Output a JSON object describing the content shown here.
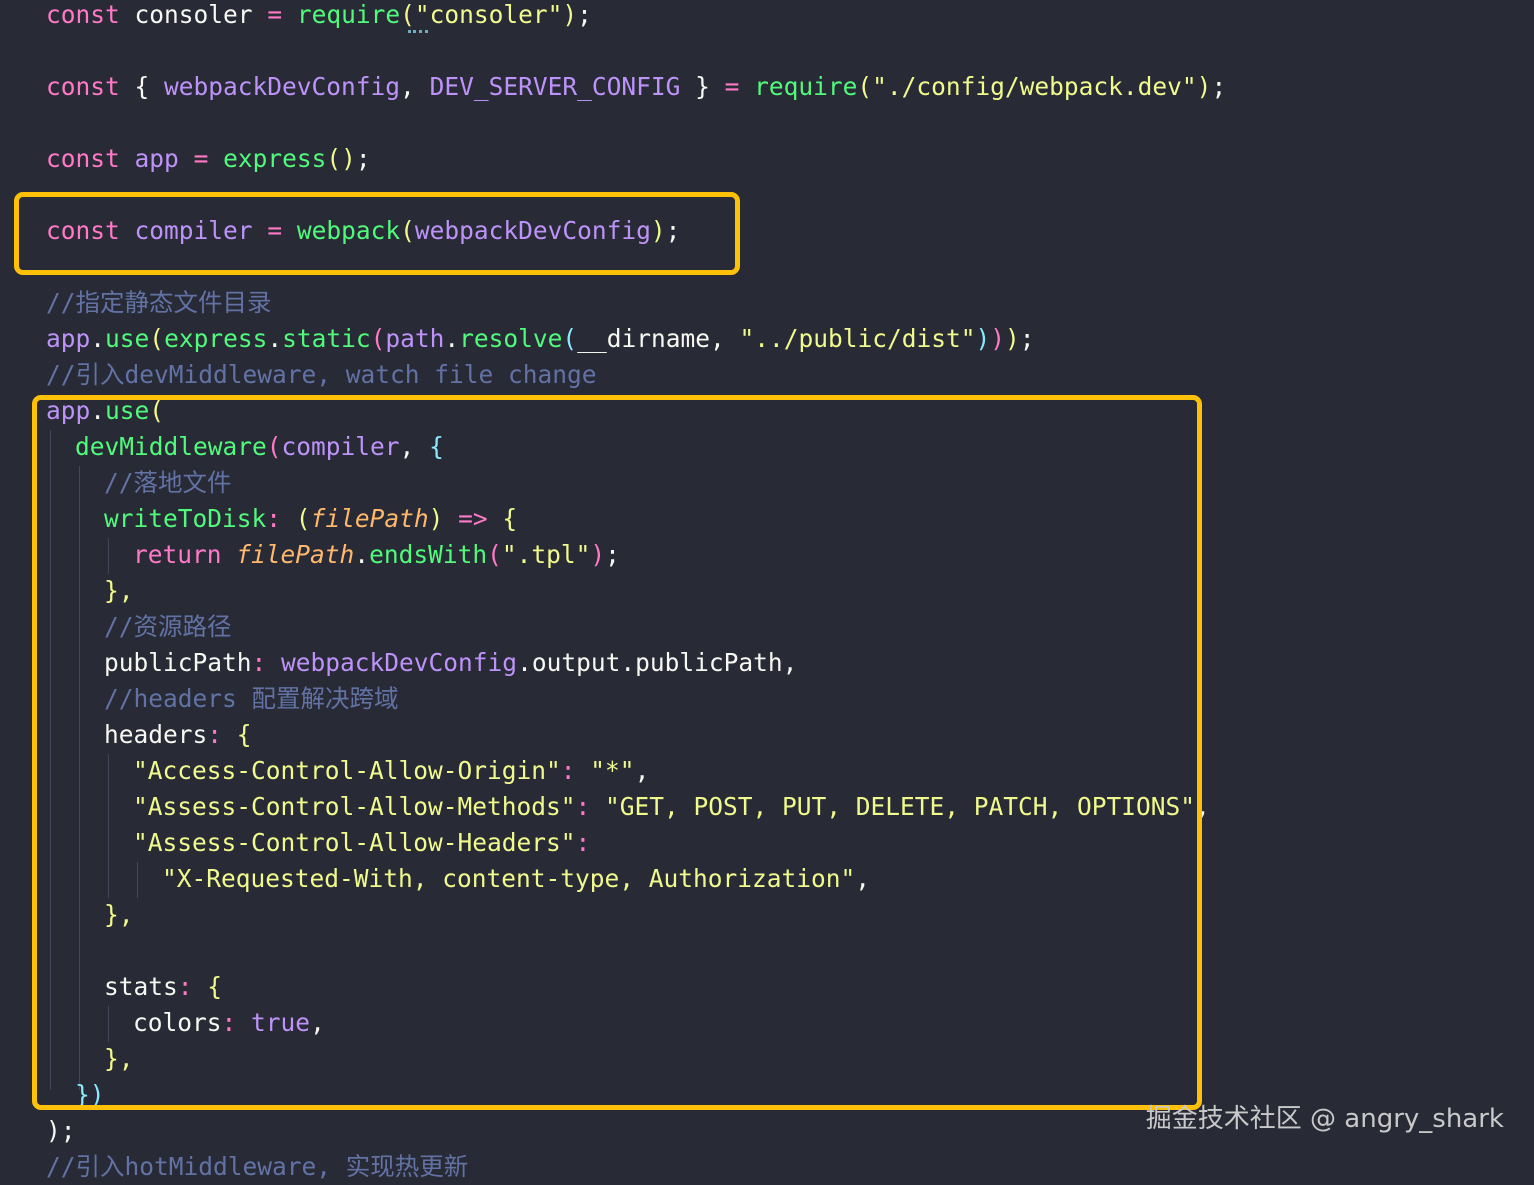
{
  "code": {
    "l1": {
      "kw": "const",
      "name": "consoler",
      "eq": "=",
      "fn": "require",
      "str": "\"consoler\""
    },
    "l2": {
      "kw": "const",
      "name1": "webpackDevConfig",
      "name2": "DEV_SERVER_CONFIG",
      "eq": "=",
      "fn": "require",
      "str": "\"./config/webpack.dev\""
    },
    "l3": {
      "kw": "const",
      "name": "app",
      "eq": "=",
      "fn": "express"
    },
    "l4": {
      "kw": "const",
      "name": "compiler",
      "eq": "=",
      "fn": "webpack",
      "arg": "webpackDevConfig"
    },
    "l5": {
      "comment": "//指定静态文件目录"
    },
    "l6": {
      "obj": "app",
      "m1": "use",
      "o2": "express",
      "m2": "static",
      "o3": "path",
      "m3": "resolve",
      "arg": "__dirname",
      "str": "\"../public/dist\""
    },
    "l7": {
      "comment": "//引入devMiddleware, watch file change"
    },
    "l8": {
      "obj": "app",
      "m": "use"
    },
    "l9": {
      "fn": "devMiddleware",
      "arg": "compiler"
    },
    "l10": {
      "comment": "//落地文件"
    },
    "l11": {
      "key": "writeToDisk",
      "param": "filePath",
      "arrow": "=>"
    },
    "l12": {
      "kw": "return",
      "param": "filePath",
      "m": "endsWith",
      "str": "\".tpl\""
    },
    "l13": {
      "close": "},"
    },
    "l14": {
      "comment": "//资源路径"
    },
    "l15": {
      "key": "publicPath",
      "v": "webpackDevConfig",
      "rest": ".output.publicPath,"
    },
    "l16": {
      "comment": "//headers 配置解决跨域"
    },
    "l17": {
      "key": "headers"
    },
    "l18": {
      "k": "\"Access-Control-Allow-Origin\"",
      "v": "\"*\""
    },
    "l19": {
      "k": "\"Assess-Control-Allow-Methods\"",
      "v": "\"GET, POST, PUT, DELETE, PATCH, OPTIONS\""
    },
    "l20": {
      "k": "\"Assess-Control-Allow-Headers\""
    },
    "l21": {
      "v": "\"X-Requested-With, content-type, Authorization\""
    },
    "l22": {
      "close": "},"
    },
    "l23": {
      "key": "stats"
    },
    "l24": {
      "key": "colors",
      "v": "true"
    },
    "l25": {
      "close": "},"
    },
    "l26": {
      "close": "})"
    },
    "l27": {
      "close": ");"
    },
    "l28": {
      "comment": "//引入hotMiddleware, 实现热更新"
    }
  },
  "watermark": "掘金技术社区 @ angry_shark",
  "colors": {
    "background": "#282a36",
    "highlight": "#ffc107"
  }
}
